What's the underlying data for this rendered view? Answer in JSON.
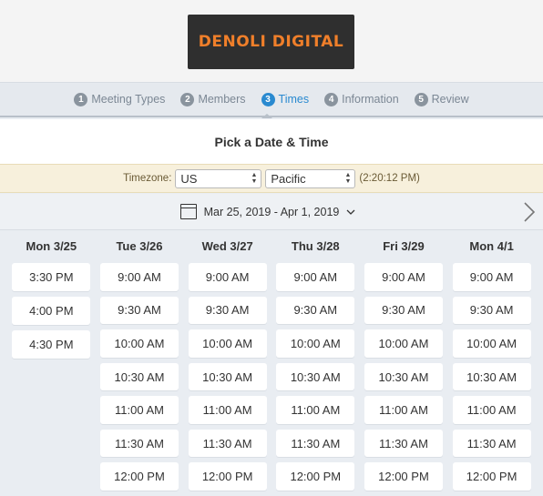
{
  "brand": {
    "logo_text": "DENOLI DIGITAL",
    "logo_color": "#f07f2a"
  },
  "steps": [
    {
      "num": "1",
      "label": "Meeting Types",
      "active": false
    },
    {
      "num": "2",
      "label": "Members",
      "active": false
    },
    {
      "num": "3",
      "label": "Times",
      "active": true
    },
    {
      "num": "4",
      "label": "Information",
      "active": false
    },
    {
      "num": "5",
      "label": "Review",
      "active": false
    }
  ],
  "page_title": "Pick a Date & Time",
  "timezone": {
    "label": "Timezone:",
    "country": "US",
    "zone": "Pacific",
    "current_time": "(2:20:12 PM)"
  },
  "date_range": {
    "text": "Mar 25, 2019 - Apr 1, 2019"
  },
  "icons": {
    "calendar": "calendar-icon",
    "chevron": "chevron-down-icon",
    "next": "chevron-right-icon"
  },
  "accent_color": "#2a8ad0",
  "days": [
    {
      "label": "Mon 3/25",
      "slots": [
        "3:30 PM",
        "4:00 PM",
        "4:30 PM"
      ]
    },
    {
      "label": "Tue 3/26",
      "slots": [
        "9:00 AM",
        "9:30 AM",
        "10:00 AM",
        "10:30 AM",
        "11:00 AM",
        "11:30 AM",
        "12:00 PM"
      ]
    },
    {
      "label": "Wed 3/27",
      "slots": [
        "9:00 AM",
        "9:30 AM",
        "10:00 AM",
        "10:30 AM",
        "11:00 AM",
        "11:30 AM",
        "12:00 PM"
      ]
    },
    {
      "label": "Thu 3/28",
      "slots": [
        "9:00 AM",
        "9:30 AM",
        "10:00 AM",
        "10:30 AM",
        "11:00 AM",
        "11:30 AM",
        "12:00 PM"
      ]
    },
    {
      "label": "Fri 3/29",
      "slots": [
        "9:00 AM",
        "9:30 AM",
        "10:00 AM",
        "10:30 AM",
        "11:00 AM",
        "11:30 AM",
        "12:00 PM"
      ]
    },
    {
      "label": "Mon 4/1",
      "slots": [
        "9:00 AM",
        "9:30 AM",
        "10:00 AM",
        "10:30 AM",
        "11:00 AM",
        "11:30 AM",
        "12:00 PM"
      ]
    }
  ]
}
